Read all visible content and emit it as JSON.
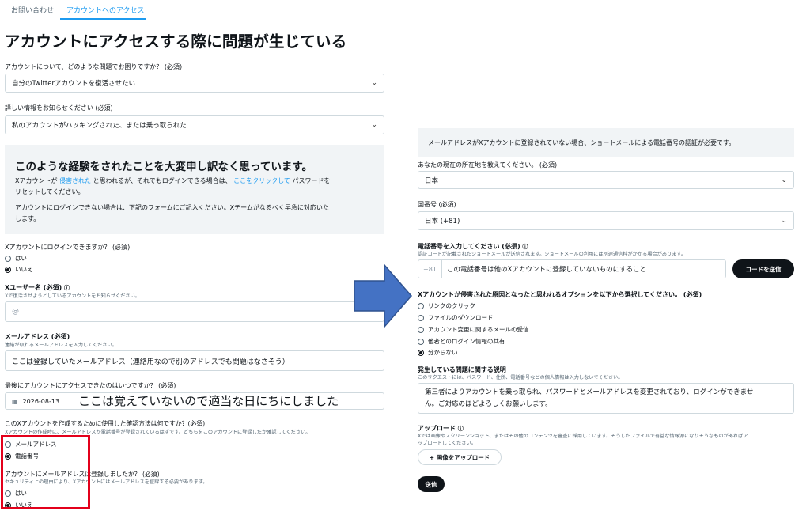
{
  "tabs": {
    "contact": "お問い合わせ",
    "access": "アカウントへのアクセス"
  },
  "page_title": "アカウントにアクセスする際に問題が生じている",
  "q_problem": {
    "label": "アカウントについて、どのような問題でお困りですか？ (必須)",
    "value": "自分のTwitterアカウントを復活させたい"
  },
  "q_detail": {
    "label": "詳しい情報をお知らせください (必須)",
    "value": "私のアカウントがハッキングされた、または乗っ取られた"
  },
  "info": {
    "heading": "このような経験をされたことを大変申し訳なく思っています。",
    "p1_a": "Xアカウントが",
    "p1_link1": "侵害された",
    "p1_b": "と思われるが、それでもログインできる場合は、",
    "p1_link2": "ここをクリックして",
    "p1_c": "パスワードを",
    "p1_line2": "リセットしてください。",
    "p2_line1": "アカウントにログインできない場合は、下記のフォームにご記入ください。Xチームがなるべく早急に対応いた",
    "p2_line2": "します。"
  },
  "q_can_login": {
    "label": "Xアカウントにログインできますか？ (必須)",
    "opt_yes": "はい",
    "opt_no": "いいえ"
  },
  "q_username": {
    "label": "Xユーザー名 (必須)",
    "help": "Xで復活させようとしているアカウントをお知らせください。",
    "prefix": "@"
  },
  "q_email": {
    "label": "メールアドレス (必須)",
    "help": "連絡が取れるメールアドレスを入力してください。",
    "value": "ここは登録していたメールアドレス（連絡用なので別のアドレスでも問題はなさそう）"
  },
  "q_last_access": {
    "label": "最後にアカウントにアクセスできたのはいつですか？ (必須)",
    "value": "2026-08-13"
  },
  "annotation_text": "ここは覚えていないので適当な日にちにしました",
  "q_verify": {
    "label": "このXアカウントを作成するために使用した確認方法は何ですか？(必須)",
    "help": "Xアカウントの作成時に、メールアドレスか電話番号が登録されているはずです。どちらをこのアカウントに登録したか確認してください。",
    "opt_email": "メールアドレス",
    "opt_phone": "電話番号"
  },
  "q_email_registered": {
    "label": "アカウントにメールアドレスは登録しましたか？ (必須)",
    "help": "セキュリティ上の理由により、Xアカウントにはメールアドレスを登録する必要があります。",
    "opt_yes": "はい",
    "opt_no": "いいえ"
  },
  "banner": "メールアドレスがXアカウントに登録されていない場合、ショートメールによる電話番号の認証が必要です。",
  "q_location": {
    "label": "あなたの現在の所在地を教えてください。 (必須)",
    "value": "日本"
  },
  "q_country_code": {
    "label": "国番号 (必須)",
    "value": "日本 (+81)"
  },
  "q_phone": {
    "label": "電話番号を入力してください (必須)",
    "help": "認証コードが記載されたショートメールが送信されます。ショートメールの利用には別途通信料がかかる場合があります。",
    "prefix": "+81",
    "value": "この電話番号は他のXアカウントに登録していないものにすること",
    "send_code": "コードを送信"
  },
  "q_cause": {
    "label": "Xアカウントが侵害された原因となったと思われるオプションを以下から選択してください。 (必須)",
    "options": [
      "リンクのクリック",
      "ファイルのダウンロード",
      "アカウント変更に関するメールの受信",
      "他者とのログイン情報の共有",
      "分からない"
    ]
  },
  "q_description": {
    "label": "発生している問題に関する説明",
    "help": "このリクエストには、パスワード、住所、電話番号などの個人情報は入力しないでください。",
    "line1": "第三者によりアカウントを乗っ取られ、パスワードとメールアドレスを変更されており、ログインができませ",
    "line2": "ん。ご対応のほどよろしくお願いします。"
  },
  "upload": {
    "label": "アップロード",
    "help1": "Xでは画像やスクリーンショット、またはその他のコンテンツを審査に採用しています。そうしたファイルで有益な情報源になりそうなものがあればア",
    "help2": "ップロードしてください。",
    "button": "+ 画像をアップロード"
  },
  "submit": "送信",
  "colors": {
    "accent": "#1d9bf0",
    "arrow": "#4472c4",
    "highlight": "#e3001b"
  }
}
